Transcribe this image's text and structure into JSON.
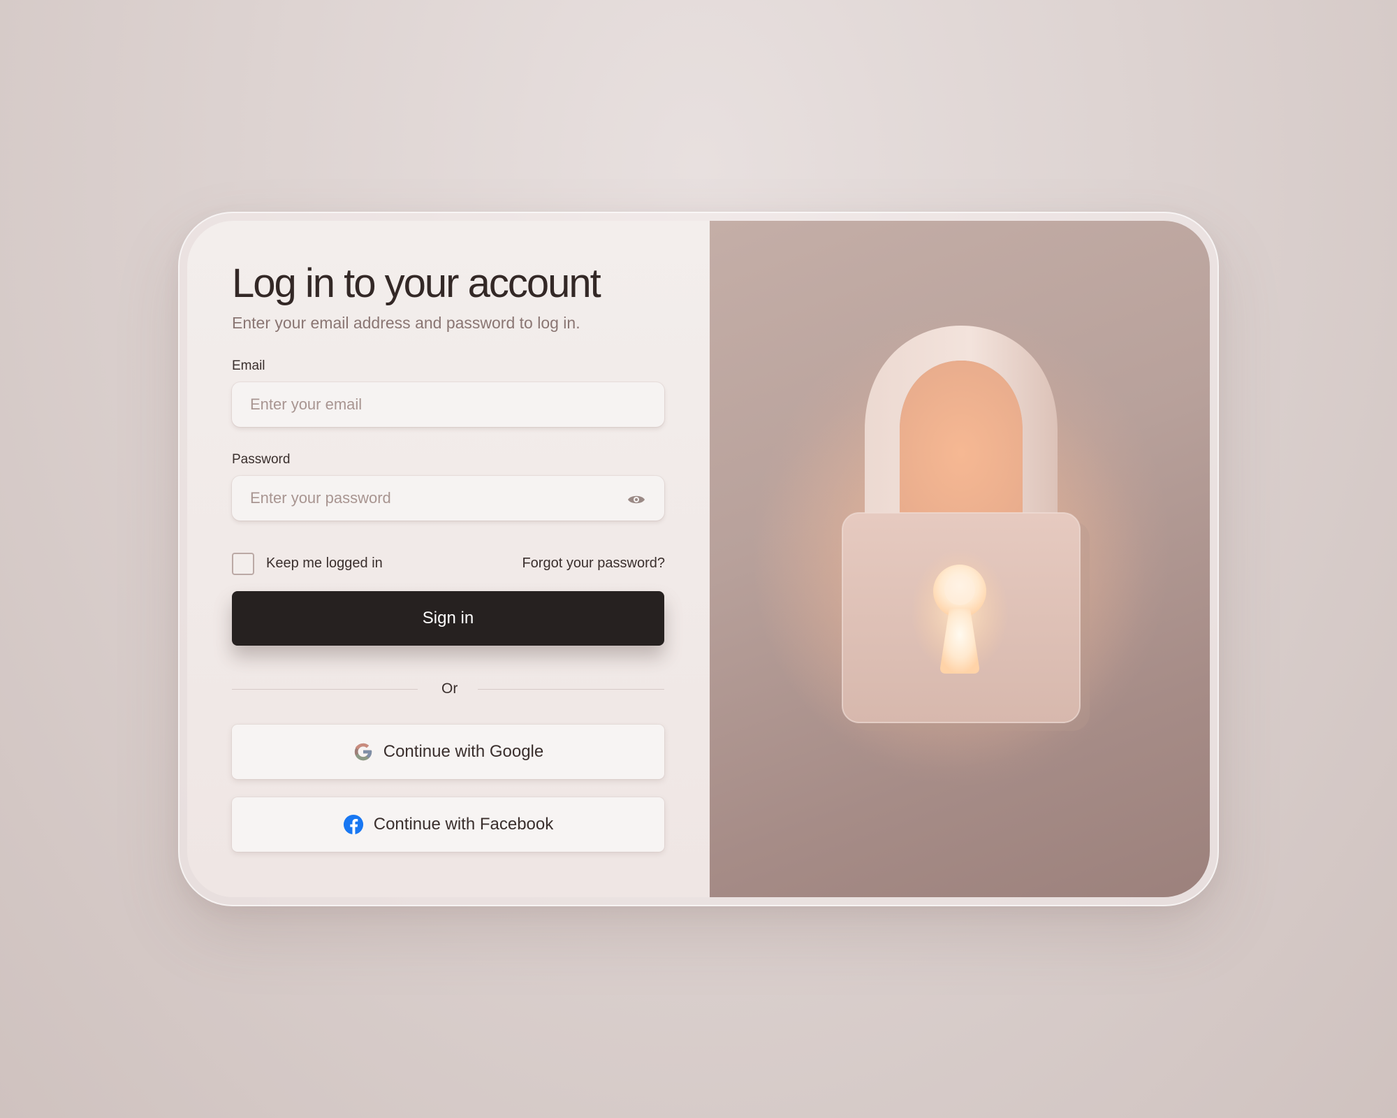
{
  "login": {
    "title": "Log in to your account",
    "subtitle": "Enter your email address and password to log in.",
    "email": {
      "label": "Email",
      "placeholder": "Enter your email",
      "value": ""
    },
    "password": {
      "label": "Password",
      "placeholder": "Enter your password",
      "value": "",
      "toggle_icon": "eye-icon"
    },
    "remember_label": "Keep me logged in",
    "forgot_label": "Forgot your password?",
    "signin_label": "Sign in",
    "divider_label": "Or",
    "google_label": "Continue with Google",
    "facebook_label": "Continue with Facebook"
  },
  "illustration": {
    "icon": "padlock-icon"
  },
  "colors": {
    "primary_button": "#262120",
    "panel_bg": "#f3eeec",
    "text": "#332826",
    "muted_text": "#8a7673",
    "facebook_blue": "#1877f2"
  }
}
